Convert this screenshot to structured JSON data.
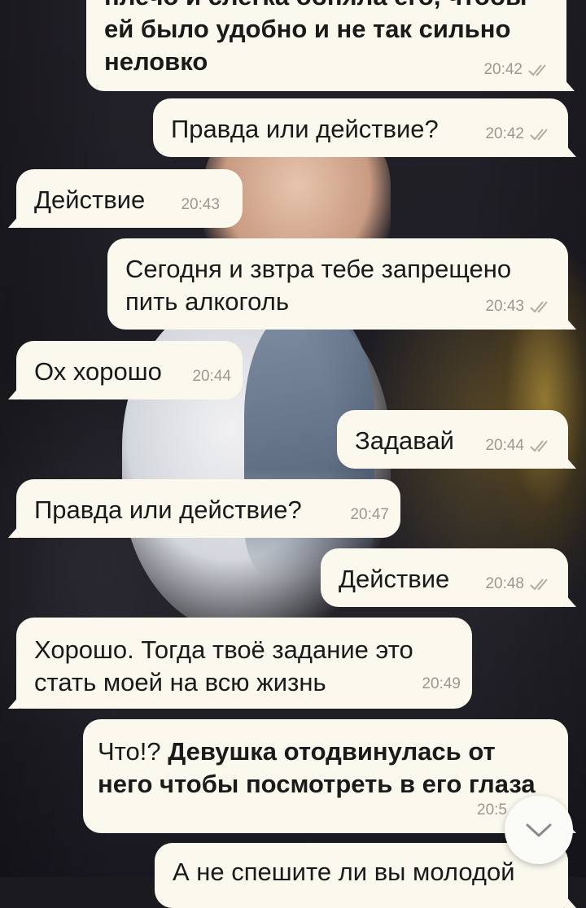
{
  "messages": [
    {
      "id": "m1",
      "dir": "out",
      "lines": [
        "плечо и слегка обняла его, чтобы",
        "ей было удобно и не так сильно",
        "неловко"
      ],
      "bold": true,
      "time": "20:42",
      "read": true
    },
    {
      "id": "m2",
      "dir": "out",
      "text": "Правда или действие?",
      "time": "20:42",
      "read": true
    },
    {
      "id": "m3",
      "dir": "in",
      "text": "Действие",
      "time": "20:43"
    },
    {
      "id": "m4",
      "dir": "out",
      "lines": [
        "Сегодня и звтра тебе запрещено",
        "пить алкоголь"
      ],
      "time": "20:43",
      "read": true
    },
    {
      "id": "m5",
      "dir": "in",
      "text": "Ох хорошо",
      "time": "20:44"
    },
    {
      "id": "m6",
      "dir": "out",
      "text": "Задавай",
      "time": "20:44",
      "read": true
    },
    {
      "id": "m7",
      "dir": "in",
      "text": "Правда или действие?",
      "time": "20:47"
    },
    {
      "id": "m8",
      "dir": "out",
      "text": "Действие",
      "time": "20:48",
      "read": true
    },
    {
      "id": "m9",
      "dir": "in",
      "lines": [
        "Хорошо. Тогда твоё задание это",
        "стать моей на всю жизнь"
      ],
      "time": "20:49"
    },
    {
      "id": "m10",
      "dir": "out",
      "normal": "Что!? ",
      "bold_text": "Девушка отодвинулась от",
      "bold_line2": "него чтобы посмотреть в его глаза",
      "time": "20:5"
    },
    {
      "id": "m11",
      "dir": "out",
      "text": "А не спешите ли вы молодой"
    }
  ],
  "icons": {
    "read": "double-check-icon",
    "scroll": "chevron-down-icon"
  },
  "colors": {
    "bubble": "#fbf8ee",
    "tick": "#b5ad9a",
    "time": "#9a9890"
  }
}
